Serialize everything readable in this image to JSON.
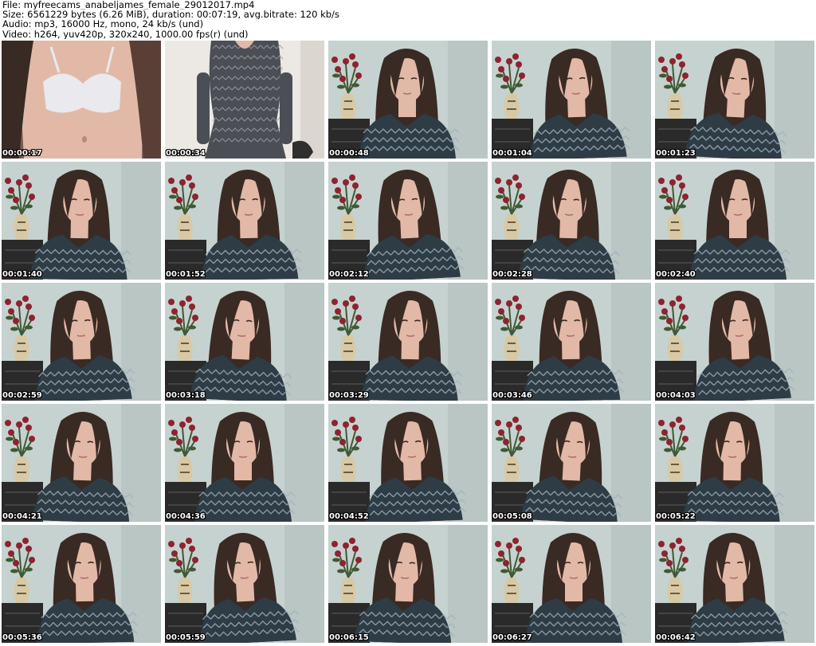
{
  "header": {
    "file_line": "File: myfreecams_anabeljames_female_29012017.mp4",
    "size_line": "Size: 6561229 bytes (6.26 MiB), duration: 00:07:19, avg.bitrate: 120 kb/s",
    "audio_line": "Audio: mp3, 16000 Hz, mono, 24 kb/s (und)",
    "video_line": "Video: h264, yuv420p, 320x240, 1000.00 fps(r) (und)"
  },
  "thumbnails": [
    {
      "time": "00:00:17",
      "scene": "closeup"
    },
    {
      "time": "00:00:34",
      "scene": "standing"
    },
    {
      "time": "00:00:48",
      "scene": "seated"
    },
    {
      "time": "00:01:04",
      "scene": "seated"
    },
    {
      "time": "00:01:23",
      "scene": "seated"
    },
    {
      "time": "00:01:40",
      "scene": "seated"
    },
    {
      "time": "00:01:52",
      "scene": "seated"
    },
    {
      "time": "00:02:12",
      "scene": "seated"
    },
    {
      "time": "00:02:28",
      "scene": "seated"
    },
    {
      "time": "00:02:40",
      "scene": "seated"
    },
    {
      "time": "00:02:59",
      "scene": "seated"
    },
    {
      "time": "00:03:18",
      "scene": "seated"
    },
    {
      "time": "00:03:29",
      "scene": "seated"
    },
    {
      "time": "00:03:46",
      "scene": "seated"
    },
    {
      "time": "00:04:03",
      "scene": "seated"
    },
    {
      "time": "00:04:21",
      "scene": "seated"
    },
    {
      "time": "00:04:36",
      "scene": "seated"
    },
    {
      "time": "00:04:52",
      "scene": "seated"
    },
    {
      "time": "00:05:08",
      "scene": "seated"
    },
    {
      "time": "00:05:22",
      "scene": "seated"
    },
    {
      "time": "00:05:36",
      "scene": "seated"
    },
    {
      "time": "00:05:59",
      "scene": "seated"
    },
    {
      "time": "00:06:15",
      "scene": "seated"
    },
    {
      "time": "00:06:27",
      "scene": "seated"
    },
    {
      "time": "00:06:42",
      "scene": "seated"
    }
  ],
  "colors": {
    "wall": "#c6d2cf",
    "hair": "#3a2a24",
    "skin": "#e2b9a6",
    "sweater": "#2e3c46",
    "sweater_pattern": "#9fb0bb",
    "vase": "#d8c9a6",
    "flowers": "#8e2330",
    "leaves": "#3f5a34",
    "dresser": "#2a2a2a",
    "bra": "#e9e9ee",
    "dress": "#4b4f55",
    "timestamp_text": "#ffffff"
  }
}
